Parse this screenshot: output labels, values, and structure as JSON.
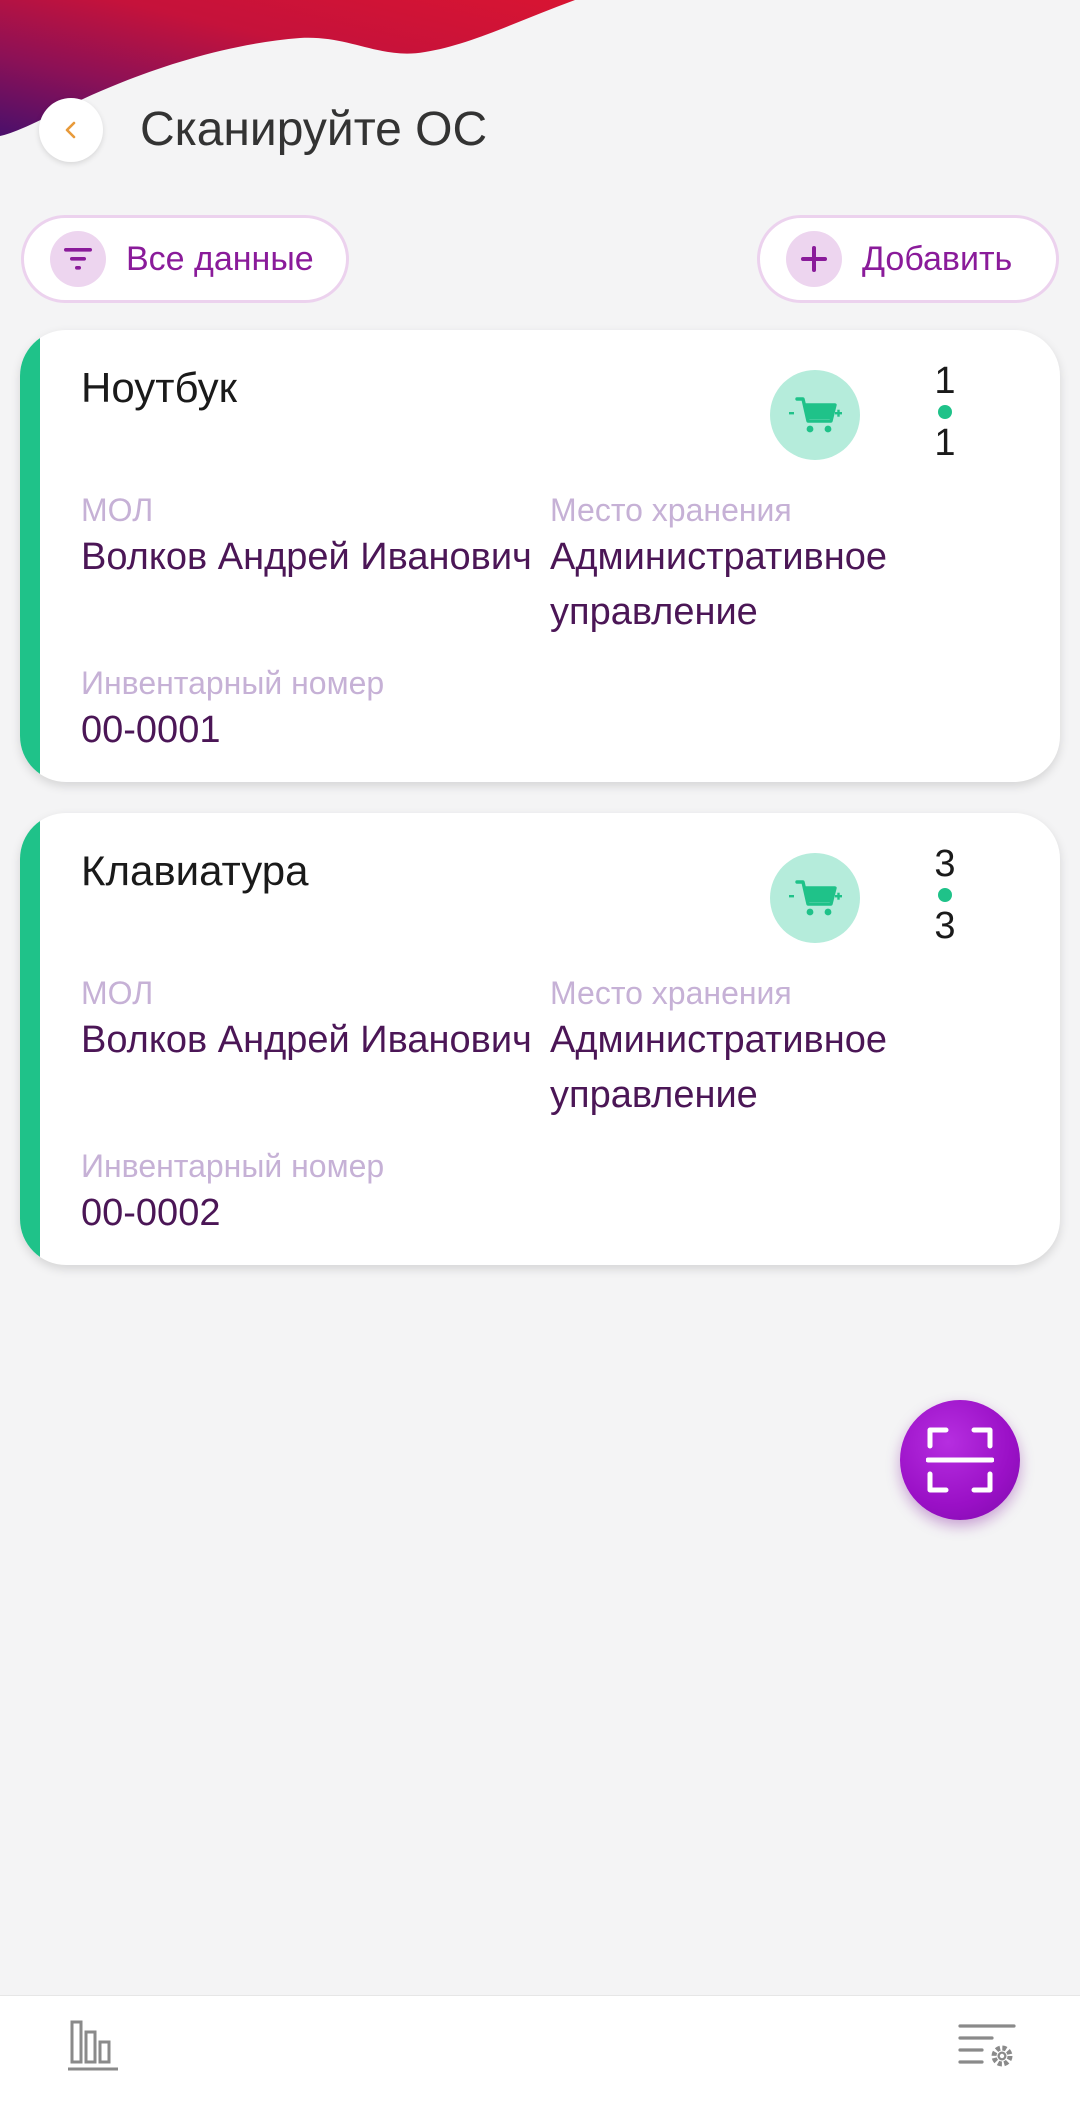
{
  "header": {
    "title": "Сканируйте ОС"
  },
  "toolbar": {
    "filter_label": "Все данные",
    "add_label": "Добавить"
  },
  "labels": {
    "mol": "МОЛ",
    "storage": "Место хранения",
    "inventory": "Инвентарный номер"
  },
  "items": [
    {
      "name": "Ноутбук",
      "count_top": "1",
      "count_bottom": "1",
      "mol": "Волков Андрей Иванович",
      "storage": "Административное управление",
      "inventory_number": "00-0001"
    },
    {
      "name": "Клавиатура",
      "count_top": "3",
      "count_bottom": "3",
      "mol": "Волков Андрей Иванович",
      "storage": "Административное управление",
      "inventory_number": "00-0002"
    }
  ],
  "icons": {
    "back": "chevron-left-icon",
    "filter": "filter-icon",
    "add": "plus-icon",
    "cart": "cart-icon",
    "scan": "scan-icon",
    "stats": "bar-chart-icon",
    "settings": "list-settings-icon"
  },
  "colors": {
    "accent": "#8a1b9a",
    "accent_light": "#edd5ef",
    "success": "#1fc289",
    "success_light": "#b5ecdb",
    "back_chevron": "#e89a3a",
    "label": "#c6b1d6",
    "value": "#4b1656"
  }
}
